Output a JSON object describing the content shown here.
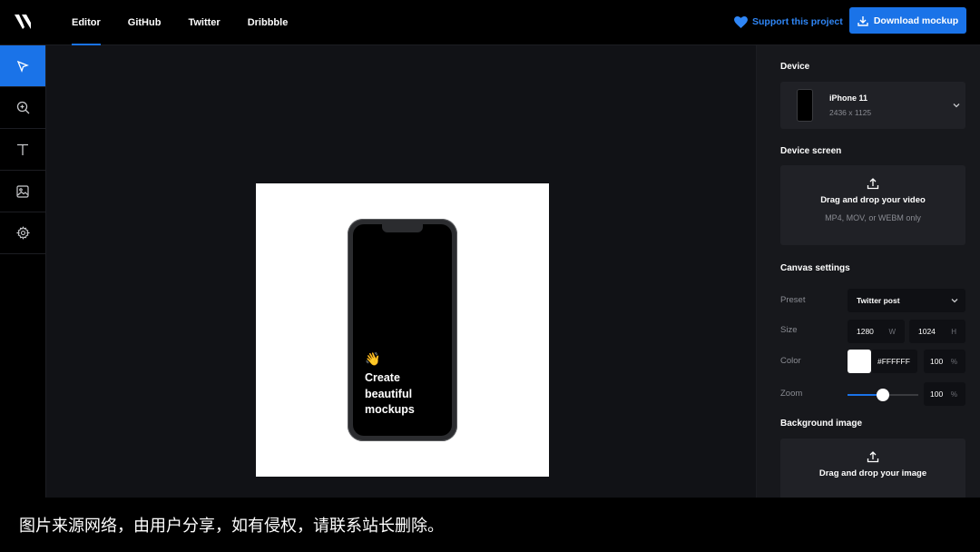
{
  "header": {
    "logo_icon": "logo-icon",
    "nav": [
      {
        "label": "Editor",
        "active": true
      },
      {
        "label": "GitHub",
        "active": false
      },
      {
        "label": "Twitter",
        "active": false
      },
      {
        "label": "Dribbble",
        "active": false
      }
    ],
    "support_label": "Support this project",
    "support_icon": "heart-icon",
    "download_label": "Download mockup",
    "download_icon": "download-icon"
  },
  "toolbar": {
    "tools": [
      {
        "name": "select-tool",
        "icon": "cursor-icon",
        "active": true
      },
      {
        "name": "zoom-tool",
        "icon": "zoom-in-icon",
        "active": false
      },
      {
        "name": "text-tool",
        "icon": "text-icon",
        "active": false
      },
      {
        "name": "image-tool",
        "icon": "image-icon",
        "active": false
      },
      {
        "name": "settings-tool",
        "icon": "gear-icon",
        "active": false
      }
    ]
  },
  "canvas": {
    "background": "#FFFFFF",
    "emoji": "👋",
    "text_lines": [
      "Create",
      "beautiful",
      "mockups"
    ]
  },
  "panel": {
    "device": {
      "title": "Device",
      "name": "iPhone 11",
      "resolution": "2436 x 1125"
    },
    "device_screen": {
      "title": "Device screen",
      "main": "Drag and drop your video",
      "sub": "MP4, MOV, or WEBM only"
    },
    "canvas_settings": {
      "title": "Canvas settings",
      "preset_label": "Preset",
      "preset_value": "Twitter post",
      "size_label": "Size",
      "width": "1280",
      "width_unit": "W",
      "height": "1024",
      "height_unit": "H",
      "color_label": "Color",
      "color_value": "#FFFFFF",
      "color_opacity": "100",
      "opacity_unit": "%",
      "zoom_label": "Zoom",
      "zoom_fraction": 0.5,
      "zoom_value": "100",
      "zoom_unit": "%"
    },
    "background_image": {
      "title": "Background image",
      "main": "Drag and drop your image"
    }
  },
  "caption": "图片来源网络，由用户分享，如有侵权，请联系站长删除。",
  "colors": {
    "accent": "#1A73E8",
    "panel": "#17181C",
    "canvas": "#111216"
  }
}
